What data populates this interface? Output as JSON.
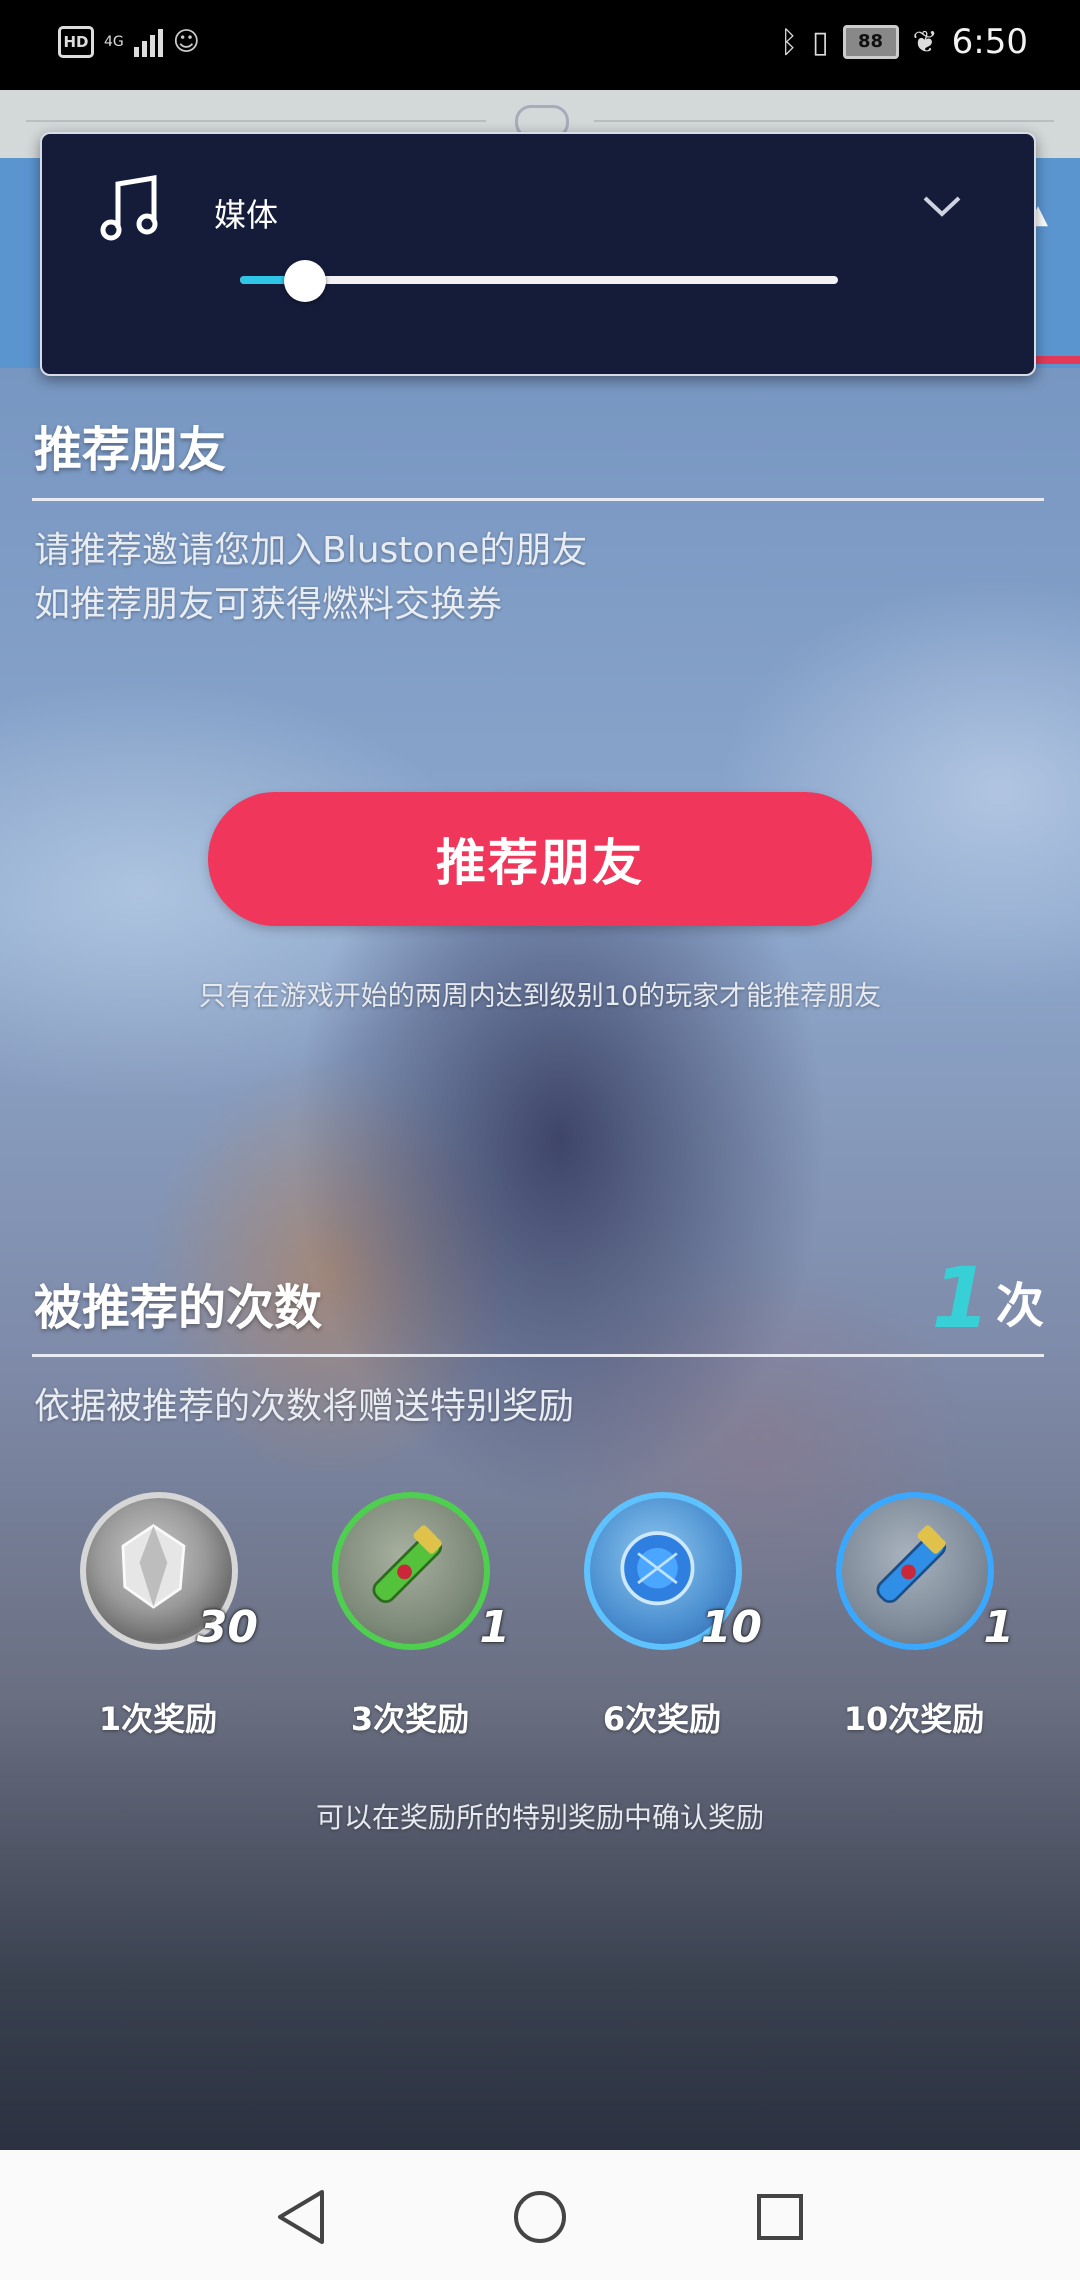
{
  "status_bar": {
    "hd": "HD",
    "network": "4G",
    "time": "6:50",
    "battery": "88"
  },
  "volume_panel": {
    "label": "媒体",
    "level": 0.08
  },
  "recommend": {
    "title": "推荐朋友",
    "desc_line1": "请推荐邀请您加入Blustone的朋友",
    "desc_line2": "如推荐朋友可获得燃料交换券",
    "button_label": "推荐朋友",
    "note": "只有在游戏开始的两周内达到级别10的玩家才能推荐朋友"
  },
  "recommended_count": {
    "title": "被推荐的次数",
    "count": "1",
    "unit": "次",
    "desc": "依据被推荐的次数将赠送特别奖励",
    "rewards": [
      {
        "icon": "silver-gem-icon",
        "qty": "30",
        "label": "1次奖励"
      },
      {
        "icon": "green-scroll-icon",
        "qty": "1",
        "label": "3次奖励"
      },
      {
        "icon": "blue-gem-icon",
        "qty": "10",
        "label": "6次奖励"
      },
      {
        "icon": "blue-scroll-icon",
        "qty": "1",
        "label": "10次奖励"
      }
    ],
    "footer_note": "可以在奖励所的特别奖励中确认奖励"
  },
  "colors": {
    "accent_red": "#f0365b",
    "count_cyan": "#37d0d6",
    "panel_bg": "#141c3a",
    "slider_fill": "#2ec5e6"
  }
}
